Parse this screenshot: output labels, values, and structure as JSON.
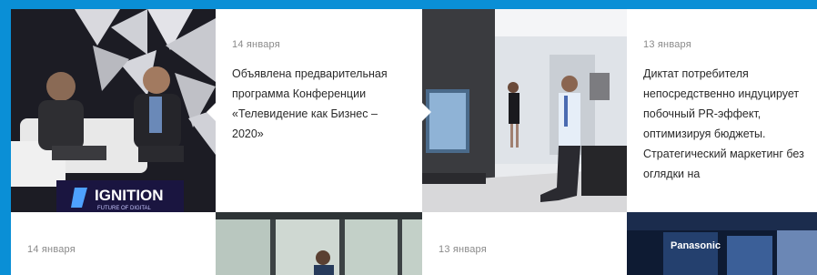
{
  "news": [
    {
      "date": "14 января",
      "title": "Объявлена предварительная программа Конференции «Телевидение как Бизнес – 2020»"
    },
    {
      "date": "13 января",
      "title": "Диктат потребителя непосредственно индуцирует побочный PR-эффект, оптимизируя бюджеты. Стратегический маркетинг без оглядки на"
    },
    {
      "date": "14 января"
    },
    {
      "date": "13 января"
    }
  ],
  "photos": [
    {
      "sign_text": "IGNITION",
      "sign_sub": "FUTURE OF DIGITAL"
    },
    {},
    {},
    {
      "brand": "Panasonic"
    }
  ],
  "colors": {
    "background": "#0a8fd6",
    "card": "#ffffff",
    "date": "#8a8a8a",
    "text": "#2a2a2a"
  }
}
